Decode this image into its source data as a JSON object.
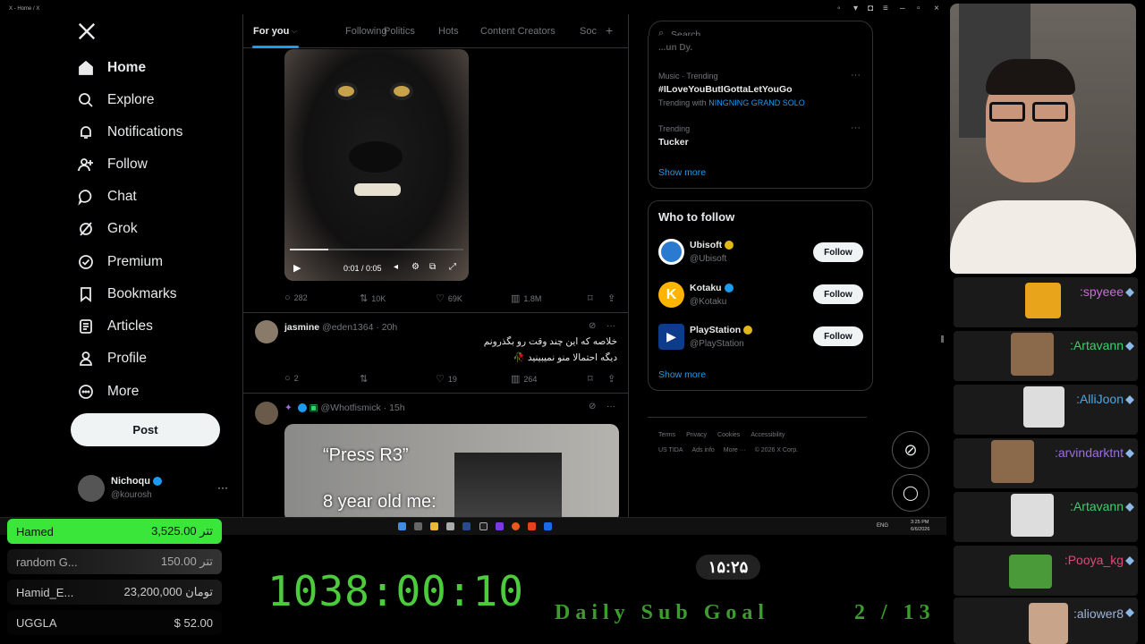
{
  "window": {
    "title": "X - Home / X"
  },
  "nav": {
    "items": [
      {
        "label": "Home"
      },
      {
        "label": "Explore"
      },
      {
        "label": "Notifications"
      },
      {
        "label": "Follow"
      },
      {
        "label": "Chat"
      },
      {
        "label": "Grok"
      },
      {
        "label": "Premium"
      },
      {
        "label": "Bookmarks"
      },
      {
        "label": "Articles"
      },
      {
        "label": "Profile"
      },
      {
        "label": "More"
      }
    ],
    "post_label": "Post",
    "account": {
      "name": "Nichoqu",
      "handle": "@kourosh",
      "more": "···"
    }
  },
  "tabs": [
    "For you",
    "Following",
    "Politics",
    "Hots",
    "Content Creators",
    "Soc"
  ],
  "video": {
    "time": "0:01 / 0:05"
  },
  "tweet1_stats": {
    "replies": "282",
    "retweets": "10K",
    "likes": "69K",
    "views": "1.8M"
  },
  "tweet2": {
    "name": "jasmine",
    "handle": "@eden1364 · 20h",
    "line1": "خلاصه که این چند وقت رو بگذرونم",
    "line2": "دیگه احتمالا منو نمیبینید 🥀",
    "replies": "2",
    "retweets": "",
    "likes": "19",
    "views": "264"
  },
  "tweet3": {
    "handle": "@Whotfismick · 15h",
    "meme_top": "“Press R3”",
    "meme_bottom": "8 year old me:"
  },
  "search": {
    "placeholder": "Search"
  },
  "trends": {
    "top_cut": "...un Dy.",
    "items": [
      {
        "meta": "Music · Trending",
        "title": "#ILoveYouButIGottaLetYouGo",
        "sub_prefix": "Trending with",
        "sub_link": "NINGNING GRAND SOLO"
      },
      {
        "meta": "Trending",
        "title": "Tucker"
      }
    ],
    "show_more": "Show more"
  },
  "who_to_follow": {
    "title": "Who to follow",
    "accounts": [
      {
        "name": "Ubisoft",
        "handle": "@Ubisoft",
        "button": "Follow"
      },
      {
        "name": "Kotaku",
        "handle": "@Kotaku",
        "button": "Follow"
      },
      {
        "name": "PlayStation",
        "handle": "@PlayStation",
        "button": "Follow"
      }
    ],
    "show_more": "Show more"
  },
  "footer": {
    "row1": [
      "Terms",
      "Privacy",
      "Cookies",
      "Accessibility"
    ],
    "row2": [
      "US TIDA",
      "Ads info",
      "More ···",
      "© 2026 X Corp."
    ]
  },
  "taskbar": {
    "lang": "ENG",
    "time": "3:25 PM",
    "date": "6/6/2026"
  },
  "chat": [
    {
      "name": ":spyeee",
      "color": "#c86fd6"
    },
    {
      "name": ":Artavann",
      "color": "#3ad16a"
    },
    {
      "name": ":AlliJoon",
      "color": "#4aa8e8"
    },
    {
      "name": ":arvindarktnt",
      "color": "#9a6ee0"
    },
    {
      "name": ":Artavann",
      "color": "#3ad16a"
    },
    {
      "name": ":Pooya_kg",
      "color": "#e04a7a"
    },
    {
      "name": ":aliower8",
      "color": "#9fb3d6"
    }
  ],
  "donations": [
    {
      "name": "Hamed",
      "amount": "3,525.00 تتر"
    },
    {
      "name": "random G...",
      "amount": "150.00 تتر"
    },
    {
      "name": "Hamid_E...",
      "amount": "23,200,000 تومان"
    },
    {
      "name": "UGGLA",
      "amount": "$ 52.00"
    }
  ],
  "overlay": {
    "timer": "1038:00:10",
    "clock": "۱۵:۲۵",
    "goal_label": "Daily Sub Goal",
    "goal_count": "2 / 13"
  },
  "colors": {
    "accent": "#1d9bf0",
    "timer_green": "#4ccb3c",
    "donation_top": "#39e639"
  }
}
